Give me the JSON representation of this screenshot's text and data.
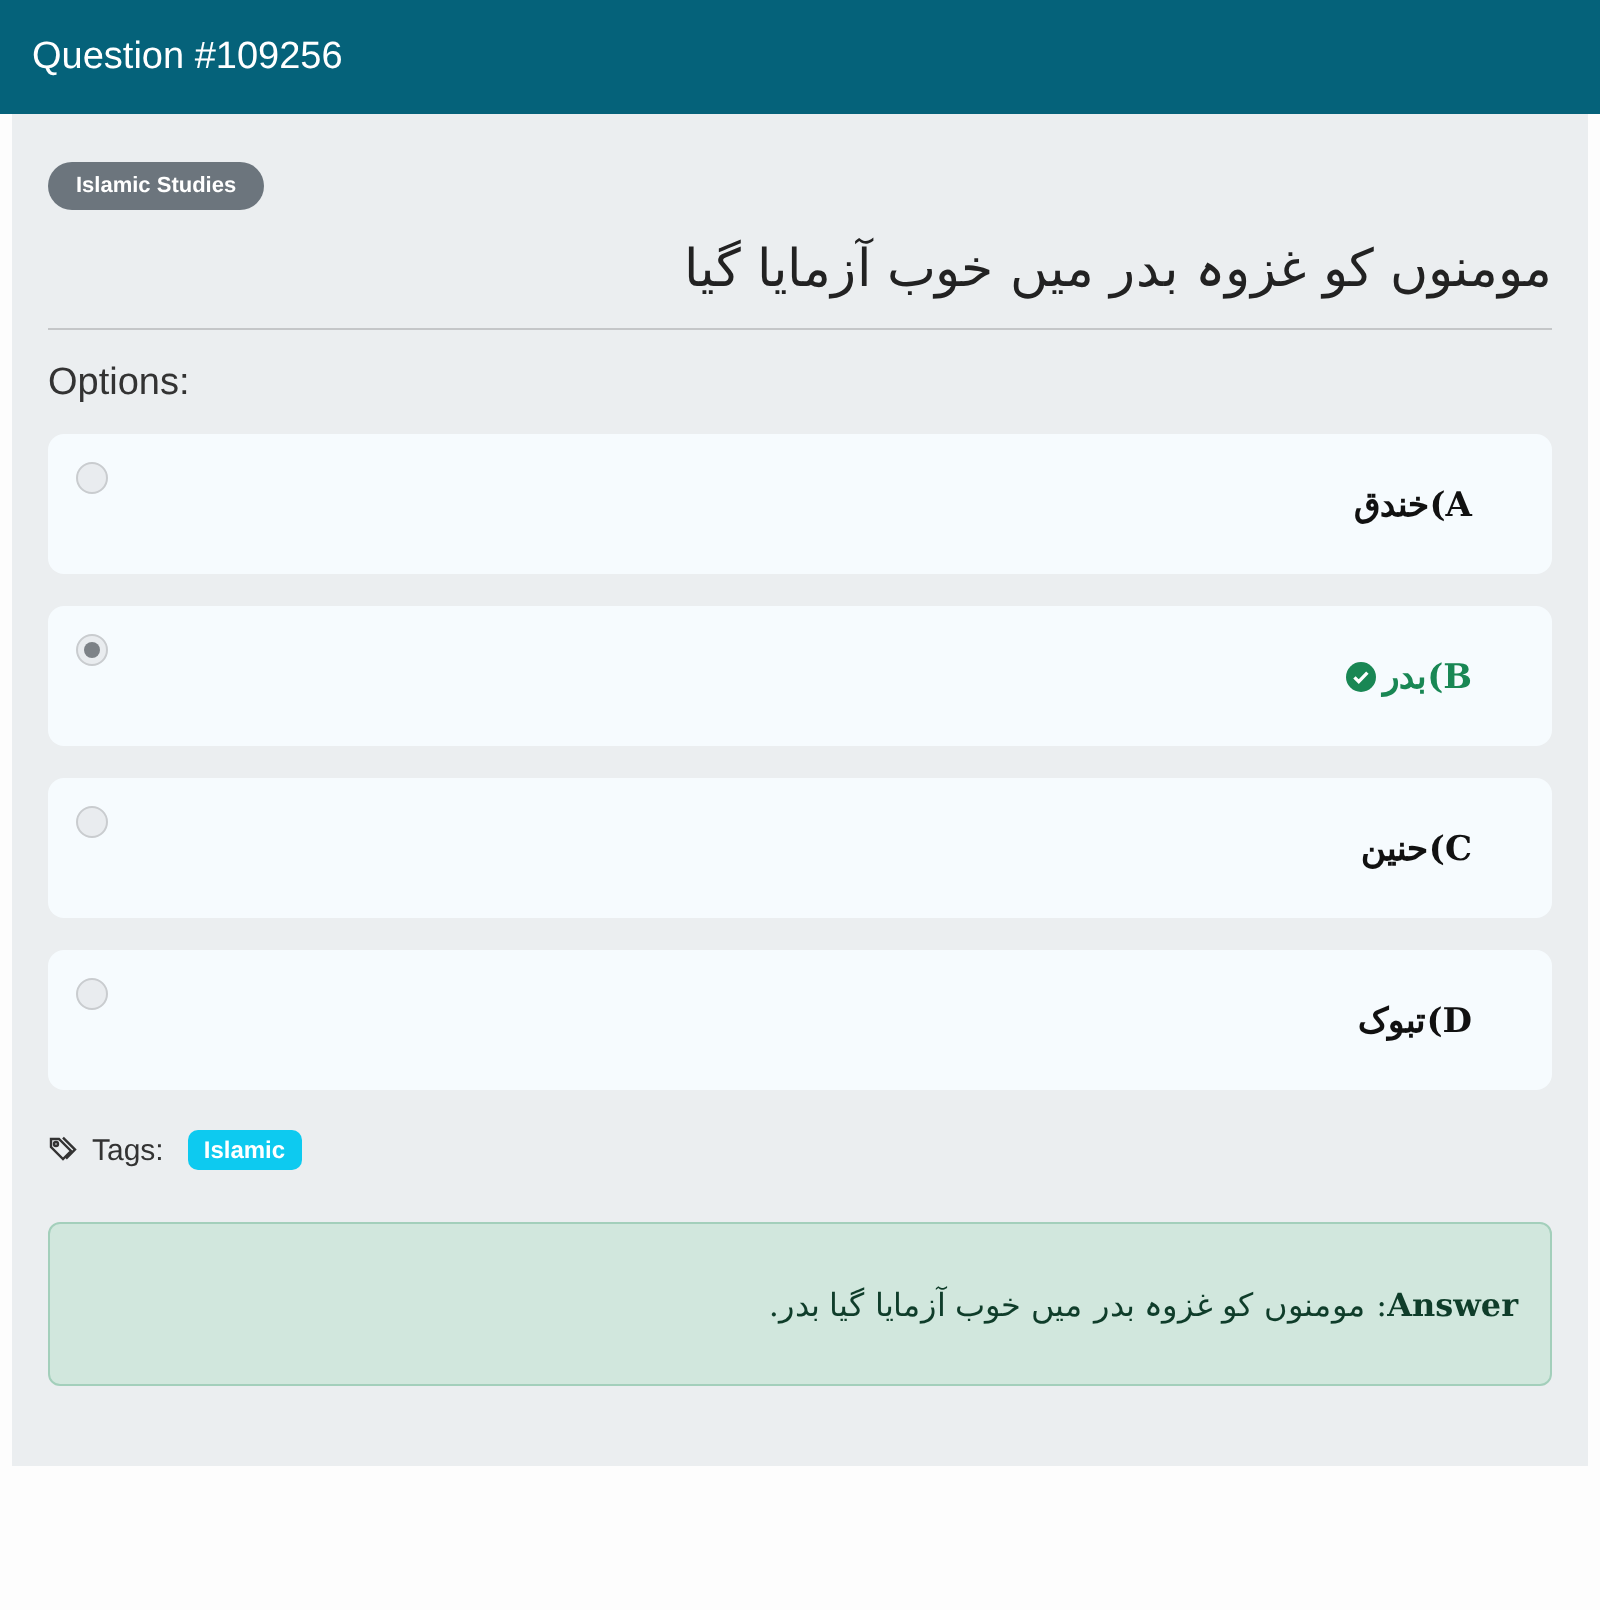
{
  "header": {
    "title": "Question #109256"
  },
  "category": "Islamic Studies",
  "question": "مومنوں کو غزوہ بدر میں خوب آزمایا گیا",
  "options_label": "Options:",
  "options": [
    {
      "text": "A)خندق",
      "selected": false,
      "correct": false
    },
    {
      "text": "B)بدر",
      "selected": true,
      "correct": true
    },
    {
      "text": "C)حنین",
      "selected": false,
      "correct": false
    },
    {
      "text": "D)تبوک",
      "selected": false,
      "correct": false
    }
  ],
  "tags_label": "Tags:",
  "tags": [
    "Islamic"
  ],
  "answer": "**Answer**: مومنوں کو غزوہ بدر میں خوب آزمایا گیا بدر."
}
